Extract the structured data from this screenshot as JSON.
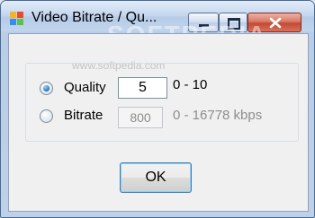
{
  "window": {
    "title": "Video Bitrate / Qu...",
    "watermark": "SOFTPEDIA"
  },
  "content": {
    "watermark_url": "www.softpedia.com"
  },
  "options": {
    "quality": {
      "label": "Quality",
      "value": "5",
      "range": "0 - 10",
      "selected": true
    },
    "bitrate": {
      "label": "Bitrate",
      "value": "800",
      "range": "0 - 16778 kbps",
      "selected": false
    }
  },
  "buttons": {
    "ok": "OK"
  },
  "icons": {
    "app": "app-icon",
    "minimize": "minimize-icon",
    "maximize": "maximize-icon",
    "close": "close-icon"
  },
  "colors": {
    "titlebar": "#c6d8ef",
    "close_button": "#c24a34",
    "radio_selected": "#1e6fc2",
    "ok_focus_border": "#3c7fb1"
  }
}
